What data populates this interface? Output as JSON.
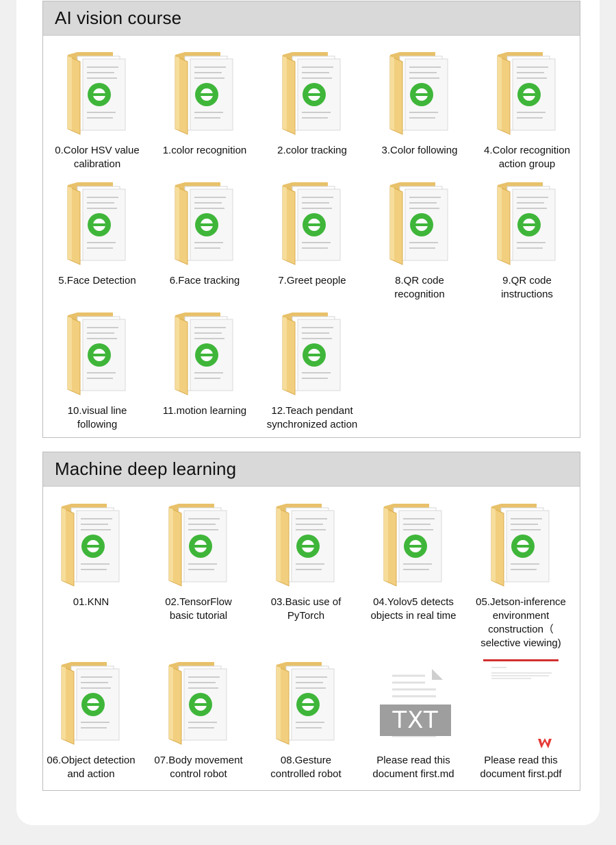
{
  "sections": [
    {
      "title": "AI vision course",
      "items": [
        {
          "label": "0.Color HSV value\ncalibration",
          "icon": "folder-icon"
        },
        {
          "label": "1.color recognition",
          "icon": "folder-icon"
        },
        {
          "label": "2.color tracking",
          "icon": "folder-icon"
        },
        {
          "label": "3.Color following",
          "icon": "folder-icon"
        },
        {
          "label": "4.Color recognition\naction group",
          "icon": "folder-icon"
        },
        {
          "label": "5.Face Detection",
          "icon": "folder-icon"
        },
        {
          "label": "6.Face tracking",
          "icon": "folder-icon"
        },
        {
          "label": "7.Greet people",
          "icon": "folder-icon"
        },
        {
          "label": "8.QR code\nrecognition",
          "icon": "folder-icon"
        },
        {
          "label": "9.QR code\ninstructions",
          "icon": "folder-icon"
        },
        {
          "label": "10.visual line\nfollowing",
          "icon": "folder-icon"
        },
        {
          "label": "11.motion learning",
          "icon": "folder-icon"
        },
        {
          "label": "12.Teach pendant\nsynchronized action",
          "icon": "folder-icon"
        }
      ]
    },
    {
      "title": "Machine deep learning",
      "items": [
        {
          "label": "01.KNN",
          "icon": "folder-icon"
        },
        {
          "label": "02.TensorFlow\nbasic tutorial",
          "icon": "folder-icon"
        },
        {
          "label": "03.Basic use of\nPyTorch",
          "icon": "folder-icon"
        },
        {
          "label": "04.Yolov5 detects\nobjects in real time",
          "icon": "folder-icon"
        },
        {
          "label": "05.Jetson-inference\nenvironment\nconstruction（\nselective viewing)",
          "icon": "folder-icon"
        },
        {
          "label": "06.Object detection\nand action",
          "icon": "folder-icon"
        },
        {
          "label": "07.Body movement\ncontrol robot",
          "icon": "folder-icon"
        },
        {
          "label": "08.Gesture\ncontrolled robot",
          "icon": "folder-icon"
        },
        {
          "label": "Please read this\ndocument first.md",
          "icon": "txt-file-icon",
          "badge": "TXT"
        },
        {
          "label": "Please read this\ndocument first.pdf",
          "icon": "pdf-file-icon"
        }
      ]
    }
  ]
}
